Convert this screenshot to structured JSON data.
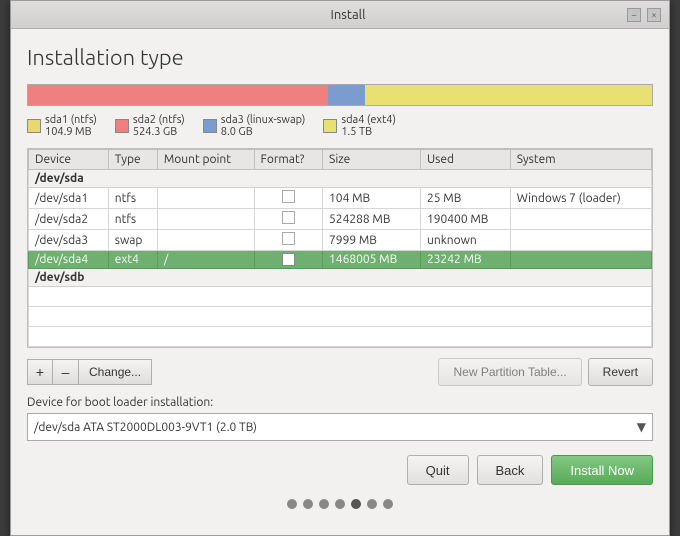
{
  "window": {
    "title": "Install",
    "minimize_label": "–",
    "close_label": "×"
  },
  "page": {
    "title": "Installation type"
  },
  "partition_bar": {
    "segments": [
      {
        "id": "sda1",
        "color": "#f87070",
        "pct": 8
      },
      {
        "id": "sda2",
        "color": "#f08080",
        "pct": 40
      },
      {
        "id": "sda3",
        "color": "#7b9cce",
        "pct": 6
      },
      {
        "id": "sda4",
        "color": "#e8e070",
        "pct": 46
      }
    ]
  },
  "legend": [
    {
      "color": "#e8d870",
      "label": "sda1 (ntfs)",
      "sublabel": "104.9 MB"
    },
    {
      "color": "#f08080",
      "label": "sda2 (ntfs)",
      "sublabel": "524.3 GB"
    },
    {
      "color": "#7b9cce",
      "label": "sda3 (linux-swap)",
      "sublabel": "8.0 GB"
    },
    {
      "color": "#e8e850",
      "label": "sda4 (ext4)",
      "sublabel": "1.5 TB"
    }
  ],
  "table": {
    "headers": [
      "Device",
      "Type",
      "Mount point",
      "Format?",
      "Size",
      "Used",
      "System"
    ],
    "groups": [
      {
        "group": "/dev/sda",
        "rows": [
          {
            "device": "/dev/sda1",
            "type": "ntfs",
            "mount": "",
            "format": false,
            "size": "104 MB",
            "used": "25 MB",
            "system": "Windows 7 (loader)",
            "selected": false
          },
          {
            "device": "/dev/sda2",
            "type": "ntfs",
            "mount": "",
            "format": false,
            "size": "524288 MB",
            "used": "190400 MB",
            "system": "",
            "selected": false
          },
          {
            "device": "/dev/sda3",
            "type": "swap",
            "mount": "",
            "format": false,
            "size": "7999 MB",
            "used": "unknown",
            "system": "",
            "selected": false
          },
          {
            "device": "/dev/sda4",
            "type": "ext4",
            "mount": "/",
            "format": true,
            "size": "1468005 MB",
            "used": "23242 MB",
            "system": "",
            "selected": true
          }
        ]
      },
      {
        "group": "/dev/sdb",
        "rows": []
      }
    ]
  },
  "controls": {
    "add_label": "+",
    "remove_label": "–",
    "change_label": "Change...",
    "new_partition_label": "New Partition Table...",
    "revert_label": "Revert"
  },
  "boot_loader": {
    "label": "Device for boot loader installation:",
    "value": "/dev/sda  ATA ST2000DL003-9VT1 (2.0 TB)"
  },
  "action_buttons": {
    "quit_label": "Quit",
    "back_label": "Back",
    "install_label": "Install Now"
  },
  "progress_dots": {
    "total": 7,
    "active_index": 4
  }
}
